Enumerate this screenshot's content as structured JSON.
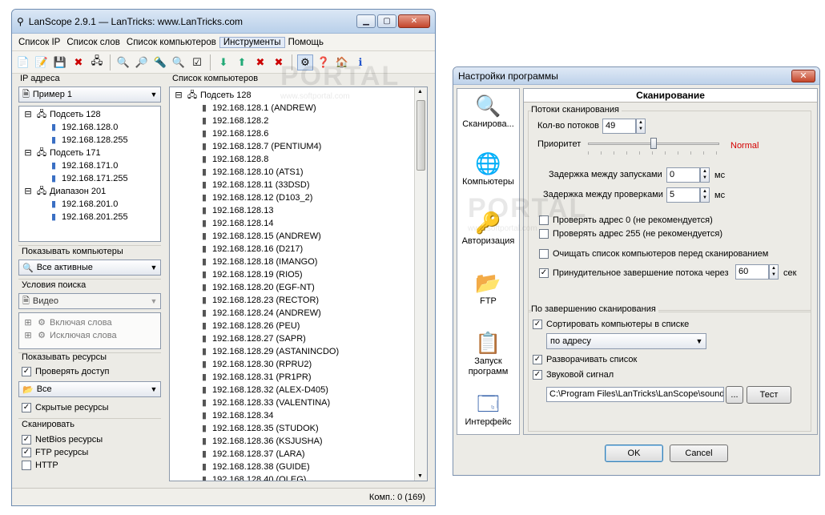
{
  "main": {
    "title": "LanScope 2.9.1 — LanTricks: www.LanTricks.com",
    "menu": [
      "Список IP",
      "Список слов",
      "Список компьютеров",
      "Инструменты",
      "Помощь"
    ],
    "ip_panel": {
      "label": "IP адреса",
      "combo": "Пример 1",
      "tree": [
        {
          "text": "Подсеть 128",
          "level": 0
        },
        {
          "text": "192.168.128.0",
          "level": 1
        },
        {
          "text": "192.168.128.255",
          "level": 1
        },
        {
          "text": "Подсеть 171",
          "level": 0
        },
        {
          "text": "192.168.171.0",
          "level": 1
        },
        {
          "text": "192.168.171.255",
          "level": 1
        },
        {
          "text": "Диапазон 201",
          "level": 0
        },
        {
          "text": "192.168.201.0",
          "level": 1
        },
        {
          "text": "192.168.201.255",
          "level": 1
        }
      ]
    },
    "show_computers": {
      "label": "Показывать компьютеры",
      "combo": "Все активные"
    },
    "search_conditions": {
      "label": "Условия поиска",
      "combo": "Видео",
      "include": "Включая слова",
      "exclude": "Исключая слова"
    },
    "show_resources": {
      "label": "Показывать ресурсы",
      "check_access": "Проверять доступ",
      "combo": "Все",
      "hidden": "Скрытые ресурсы"
    },
    "scan": {
      "label": "Сканировать",
      "netbios": "NetBios ресурсы",
      "ftp": "FTP ресурсы",
      "http": "HTTP"
    },
    "computers_panel": {
      "label": "Список компьютеров",
      "root": "Подсеть 128",
      "items": [
        "192.168.128.1 (ANDREW)",
        "192.168.128.2",
        "192.168.128.6",
        "192.168.128.7 (PENTIUM4)",
        "192.168.128.8",
        "192.168.128.10 (ATS1)",
        "192.168.128.11 (33DSD)",
        "192.168.128.12 (D103_2)",
        "192.168.128.13",
        "192.168.128.14",
        "192.168.128.15 (ANDREW)",
        "192.168.128.16 (D217)",
        "192.168.128.18 (IMANGO)",
        "192.168.128.19 (RIO5)",
        "192.168.128.20 (EGF-NT)",
        "192.168.128.23 (RECTOR)",
        "192.168.128.24 (ANDREW)",
        "192.168.128.26 (PEU)",
        "192.168.128.27 (SAPR)",
        "192.168.128.29 (ASTANINCDO)",
        "192.168.128.30 (RPRU2)",
        "192.168.128.31 (PR1PR)",
        "192.168.128.32 (ALEX-D405)",
        "192.168.128.33 (VALENTINA)",
        "192.168.128.34",
        "192.168.128.35 (STUDOK)",
        "192.168.128.36 (KSJUSHA)",
        "192.168.128.37 (LARA)",
        "192.168.128.38 (GUIDE)",
        "192.168.128.40 (OLEG)"
      ]
    },
    "status": "Комп.: 0 (169)",
    "watermark": "PORTAL",
    "watermark_url": "www.softportal.com"
  },
  "settings": {
    "title": "Настройки программы",
    "sidebar": [
      "Сканирова...",
      "Компьютеры",
      "Авторизация",
      "FTP",
      "Запуск программ",
      "Интерфейс"
    ],
    "heading": "Сканирование",
    "threads_group": "Потоки сканирования",
    "threads_label": "Кол-во потоков",
    "threads_value": "49",
    "priority_label": "Приоритет",
    "priority_value": "Normal",
    "priority_color": "#d40000",
    "delay_start_label": "Задержка между запусками",
    "delay_start_value": "0",
    "delay_check_label": "Задержка между проверками",
    "delay_check_value": "5",
    "unit_ms": "мс",
    "check_addr0": "Проверять адрес 0 (не рекомендуется)",
    "check_addr255": "Проверять адрес 255 (не рекомендуется)",
    "clear_list": "Очищать список компьютеров перед сканированием",
    "force_finish": "Принудительное завершение потока через",
    "force_value": "60",
    "unit_sec": "сек",
    "after_group": "По завершению сканирования",
    "sort_label": "Сортировать компьютеры в списке",
    "sort_value": "по адресу",
    "expand_label": "Разворачивать список",
    "sound_label": "Звуковой сигнал",
    "sound_path": "C:\\Program Files\\LanTricks\\LanScope\\sound",
    "browse": "...",
    "test": "Тест",
    "ok": "OK",
    "cancel": "Cancel"
  }
}
